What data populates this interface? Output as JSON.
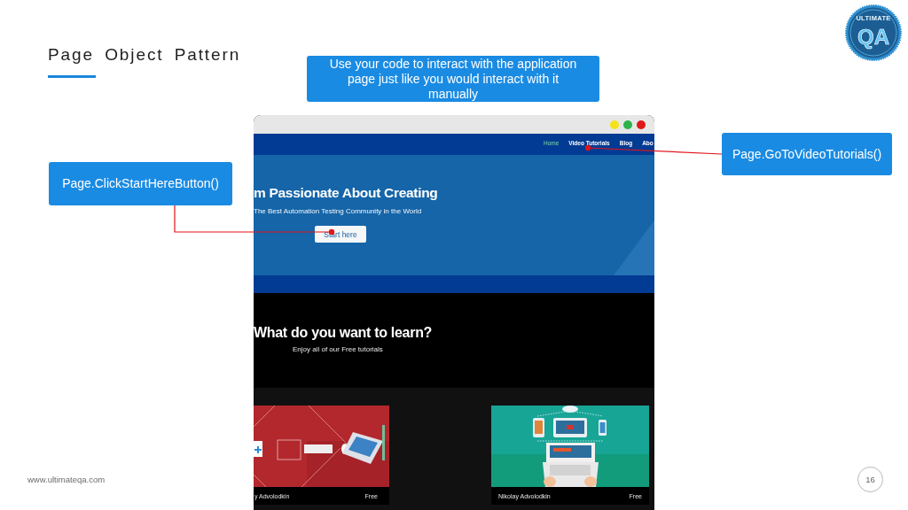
{
  "slide": {
    "title": "Page Object Pattern",
    "footer_url": "www.ultimateqa.com",
    "page_number": "16"
  },
  "logo": {
    "top_text": "ULTIMATE",
    "mark": "QA"
  },
  "callouts": [
    {
      "text": "Use your code to interact with the application page just like you would interact with it manually"
    },
    {
      "text": "Page.GoToVideoTutorials()"
    },
    {
      "text": "Page.ClickStartHereButton()"
    }
  ],
  "browser": {
    "window_controls": [
      {
        "color": "#f5e218"
      },
      {
        "color": "#2eb24b"
      },
      {
        "color": "#dd1a1a"
      }
    ],
    "nav": [
      {
        "label": "Home",
        "selected": true
      },
      {
        "label": "Video Tutorials",
        "selected": false
      },
      {
        "label": "Blog",
        "selected": false
      },
      {
        "label": "Abo",
        "selected": false
      }
    ],
    "hero": {
      "heading": "m Passionate About Creating",
      "subheading": "The Best Automation Testing Community in the World",
      "button": "Start here"
    },
    "intro": {
      "heading": "What do you want to learn?",
      "subheading": "Enjoy all of our Free tutorials"
    },
    "courses": [
      {
        "kind": "diamonds",
        "author": "y Advolodkin",
        "price": "Free"
      },
      {
        "kind": "devices",
        "author": "Nikolay Advolodkin",
        "price": "Free"
      }
    ]
  }
}
